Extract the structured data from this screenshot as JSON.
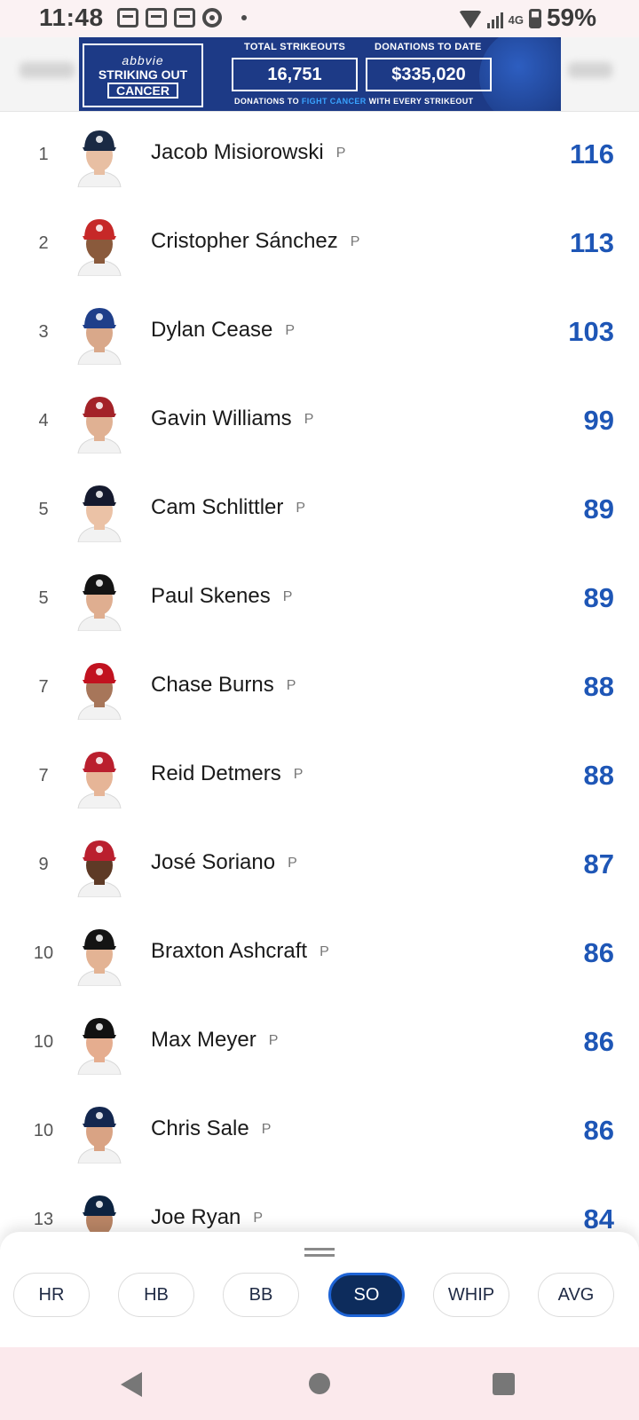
{
  "status_bar": {
    "time": "11:48",
    "network": "4G",
    "battery": "59%"
  },
  "ad": {
    "brand": "abbvie",
    "line1": "STRIKING OUT",
    "line2": "CANCER",
    "label1": "TOTAL STRIKEOUTS",
    "value1": "16,751",
    "label2": "DONATIONS TO DATE",
    "value2": "$335,020",
    "footer_a": "DONATIONS TO ",
    "footer_highlight": "FIGHT CANCER",
    "footer_b": " WITH EVERY STRIKEOUT"
  },
  "leaders": [
    {
      "rank": "1",
      "name": "Jacob Misiorowski",
      "pos": "P",
      "value": "116",
      "cap": "#1a2a44",
      "skin": "#e8bfa3"
    },
    {
      "rank": "2",
      "name": "Cristopher Sánchez",
      "pos": "P",
      "value": "113",
      "cap": "#c62828",
      "skin": "#8a5a3c"
    },
    {
      "rank": "3",
      "name": "Dylan Cease",
      "pos": "P",
      "value": "103",
      "cap": "#1f3f8a",
      "skin": "#d9a88a"
    },
    {
      "rank": "4",
      "name": "Gavin Williams",
      "pos": "P",
      "value": "99",
      "cap": "#a32228",
      "skin": "#e0b193"
    },
    {
      "rank": "5",
      "name": "Cam Schlittler",
      "pos": "P",
      "value": "89",
      "cap": "#151a2e",
      "skin": "#ebc2a6"
    },
    {
      "rank": "5",
      "name": "Paul Skenes",
      "pos": "P",
      "value": "89",
      "cap": "#141414",
      "skin": "#dfae90"
    },
    {
      "rank": "7",
      "name": "Chase Burns",
      "pos": "P",
      "value": "88",
      "cap": "#c1121f",
      "skin": "#a7765a"
    },
    {
      "rank": "7",
      "name": "Reid Detmers",
      "pos": "P",
      "value": "88",
      "cap": "#ba1f2e",
      "skin": "#e6b597"
    },
    {
      "rank": "9",
      "name": "José Soriano",
      "pos": "P",
      "value": "87",
      "cap": "#ba1f2e",
      "skin": "#5e3a26"
    },
    {
      "rank": "10",
      "name": "Braxton Ashcraft",
      "pos": "P",
      "value": "86",
      "cap": "#141414",
      "skin": "#e3b394"
    },
    {
      "rank": "10",
      "name": "Max Meyer",
      "pos": "P",
      "value": "86",
      "cap": "#111111",
      "skin": "#e5ad8f"
    },
    {
      "rank": "10",
      "name": "Chris Sale",
      "pos": "P",
      "value": "86",
      "cap": "#13274f",
      "skin": "#d9a384"
    },
    {
      "rank": "13",
      "name": "Joe Ryan",
      "pos": "P",
      "value": "84",
      "cap": "#0c2340",
      "skin": "#b98565"
    }
  ],
  "stat_tabs": [
    {
      "label": "HR",
      "active": false
    },
    {
      "label": "HB",
      "active": false
    },
    {
      "label": "BB",
      "active": false
    },
    {
      "label": "SO",
      "active": true
    },
    {
      "label": "WHIP",
      "active": false
    },
    {
      "label": "AVG",
      "active": false
    }
  ],
  "colors": {
    "stat_value": "#1e56b6",
    "active_tab_bg": "#0d2c5c",
    "active_tab_border": "#1e64d6",
    "ad_bg": "#1d3a86"
  },
  "icons": {
    "status_left": [
      "calendar-icon",
      "calendar-icon",
      "calendar-icon",
      "chrome-icon",
      "notification-dot-icon"
    ],
    "status_right": [
      "wifi-icon",
      "signal-icon",
      "battery-icon"
    ],
    "nav": [
      "back-icon",
      "home-icon",
      "recents-icon"
    ],
    "sheet": "drag-handle-icon"
  }
}
